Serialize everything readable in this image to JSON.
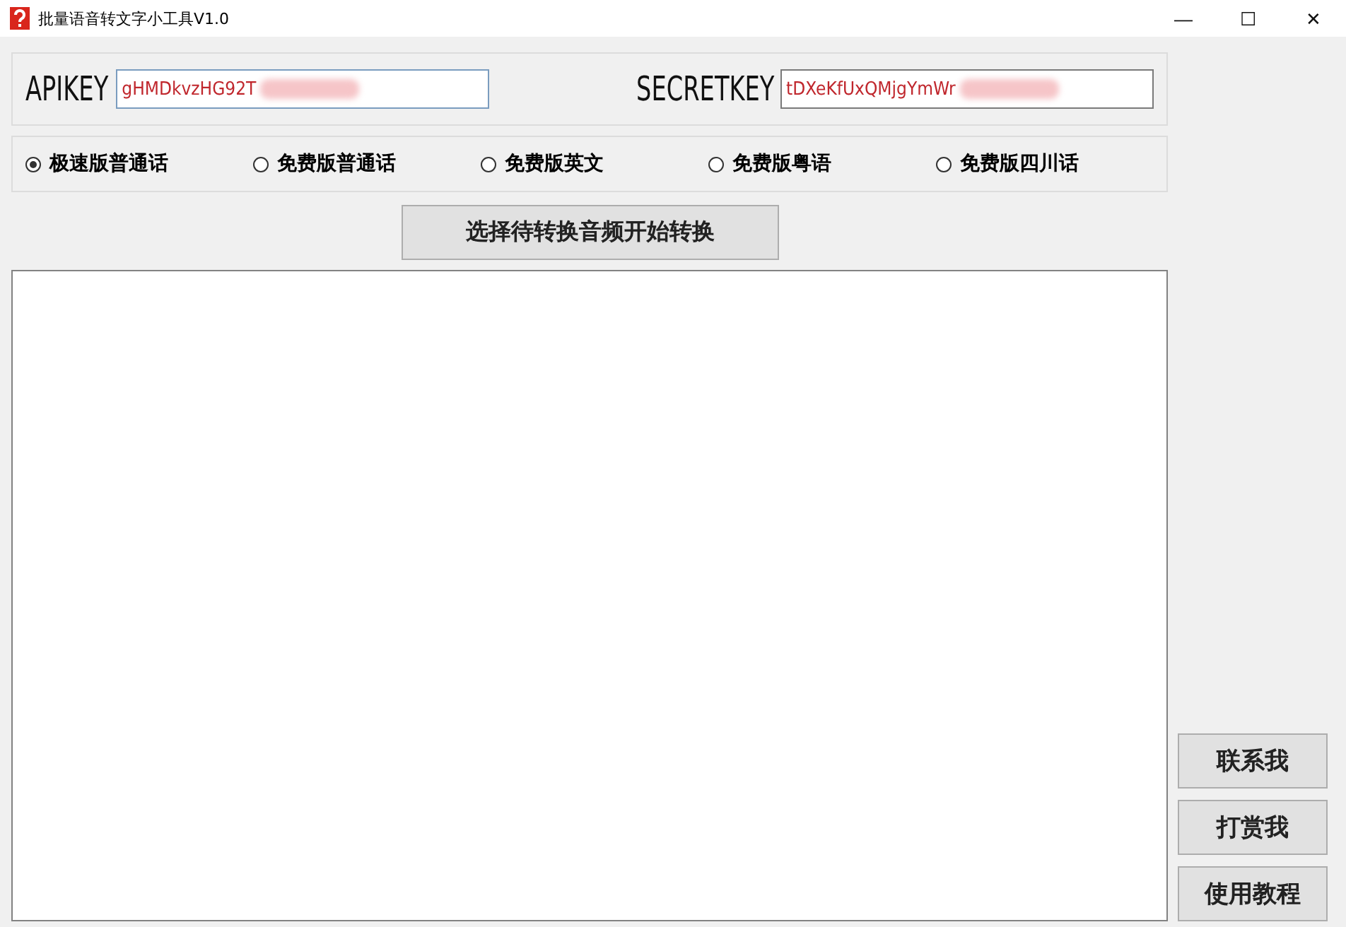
{
  "window": {
    "title": "批量语音转文字小工具V1.0",
    "controls": [
      "—",
      "☐",
      "✕"
    ]
  },
  "keys": [
    {
      "label": "APIKEY",
      "value": "gHMDkvzHG92T"
    },
    {
      "label": "SECRETKEY",
      "value": "tDXeKfUxQMjgYmWr"
    }
  ],
  "modes": [
    {
      "label": "极速版普通话",
      "selected": true
    },
    {
      "label": "免费版普通话",
      "selected": false
    },
    {
      "label": "免费版英文",
      "selected": false
    },
    {
      "label": "免费版粤语",
      "selected": false
    },
    {
      "label": "免费版四川话",
      "selected": false
    }
  ],
  "convert_button": "选择待转换音频开始转换",
  "side_buttons": [
    "联系我",
    "打赏我",
    "使用教程"
  ]
}
